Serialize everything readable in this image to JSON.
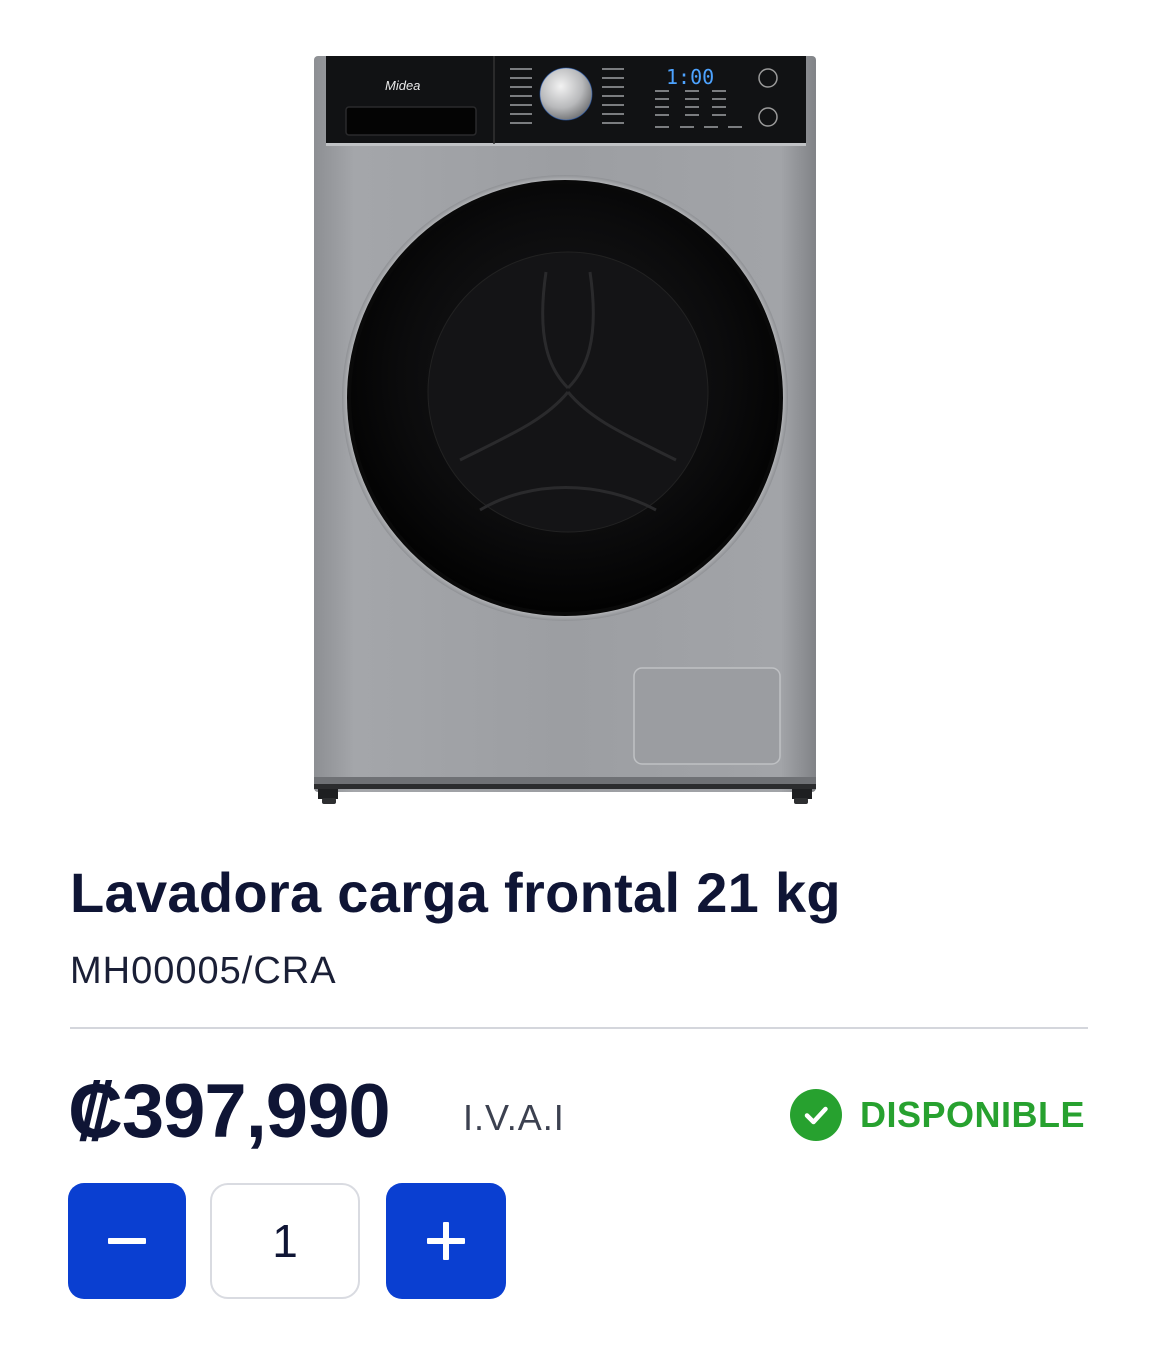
{
  "product": {
    "brand_logo": "Midea",
    "display_time": "1:00",
    "title": "Lavadora carga frontal 21 kg",
    "sku": "MH00005/CRA",
    "price": "₡397,990",
    "tax_label": "I.V.A.I",
    "availability": "DISPONIBLE"
  },
  "quantity": {
    "value": "1",
    "decrement_icon": "minus-icon",
    "increment_icon": "plus-icon"
  },
  "colors": {
    "primary_button": "#0a3fd1",
    "available": "#27a12f",
    "text": "#0f1535"
  }
}
